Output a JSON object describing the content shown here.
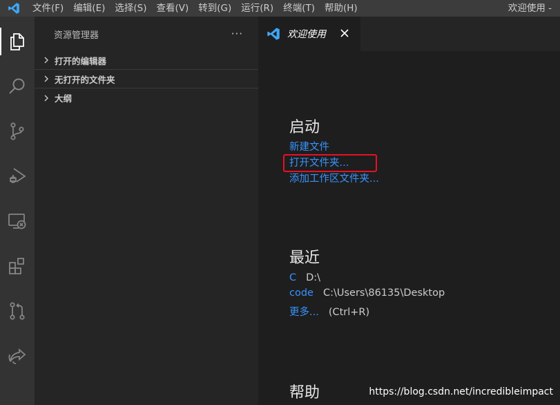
{
  "titlebar": {
    "menus": [
      "文件(F)",
      "编辑(E)",
      "选择(S)",
      "查看(V)",
      "转到(G)",
      "运行(R)",
      "终端(T)",
      "帮助(H)"
    ],
    "window_title": "欢迎使用 -"
  },
  "activitybar": {
    "icons": [
      "explorer-icon",
      "search-icon",
      "source-control-icon",
      "run-debug-icon",
      "remote-explorer-icon",
      "extensions-icon",
      "pull-request-icon",
      "live-share-icon"
    ]
  },
  "sidebar": {
    "title": "资源管理器",
    "more": "···",
    "sections": [
      {
        "label": "打开的编辑器"
      },
      {
        "label": "无打开的文件夹"
      },
      {
        "label": "大纲"
      }
    ]
  },
  "editor": {
    "tab": {
      "label": "欢迎使用"
    },
    "start": {
      "heading": "启动",
      "links": [
        "新建文件",
        "打开文件夹...",
        "添加工作区文件夹..."
      ]
    },
    "recent": {
      "heading": "最近",
      "items": [
        {
          "name": "C",
          "path": "D:\\"
        },
        {
          "name": "code",
          "path": "C:\\Users\\86135\\Desktop"
        }
      ],
      "more": {
        "label": "更多...",
        "shortcut": "(Ctrl+R)"
      }
    },
    "help": {
      "heading": "帮助"
    },
    "watermark": "https://blog.csdn.net/incredibleimpact"
  },
  "colors": {
    "accent_link": "#3794ff",
    "highlight_box": "#e81123",
    "vscode_blue": "#3ea6f5"
  }
}
